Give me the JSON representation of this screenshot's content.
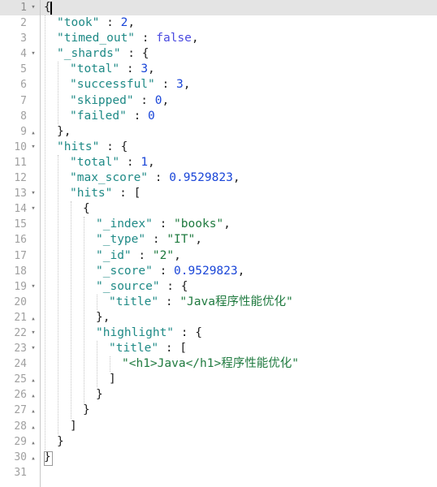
{
  "editor": {
    "title": "JSON response viewer",
    "language": "json",
    "total_lines": 31,
    "active_line": 1,
    "cursor": {
      "line": 1,
      "column": 2
    },
    "colors": {
      "background": "#ffffff",
      "active_line": "#e4e4e4",
      "gutter_border": "#c8c8c8",
      "line_number": "#a0a0a0",
      "key": "#1f8a86",
      "string": "#1f7a3f",
      "number": "#1a46d8",
      "boolean": "#4a4ae0",
      "punctuation": "#222222",
      "indent_guide": "#c4c4c4"
    },
    "fold_markers": {
      "open": "▾",
      "close": "▴"
    }
  },
  "lines": [
    {
      "num": "1",
      "fold": "open",
      "indent": 0,
      "tokens": [
        {
          "t": "p",
          "v": "{"
        }
      ]
    },
    {
      "num": "2",
      "fold": "",
      "indent": 1,
      "tokens": [
        {
          "t": "k",
          "v": "\"took\""
        },
        {
          "t": "p",
          "v": " : "
        },
        {
          "t": "n",
          "v": "2"
        },
        {
          "t": "p",
          "v": ","
        }
      ]
    },
    {
      "num": "3",
      "fold": "",
      "indent": 1,
      "tokens": [
        {
          "t": "k",
          "v": "\"timed_out\""
        },
        {
          "t": "p",
          "v": " : "
        },
        {
          "t": "b",
          "v": "false"
        },
        {
          "t": "p",
          "v": ","
        }
      ]
    },
    {
      "num": "4",
      "fold": "open",
      "indent": 1,
      "tokens": [
        {
          "t": "k",
          "v": "\"_shards\""
        },
        {
          "t": "p",
          "v": " : {"
        }
      ]
    },
    {
      "num": "5",
      "fold": "",
      "indent": 2,
      "tokens": [
        {
          "t": "k",
          "v": "\"total\""
        },
        {
          "t": "p",
          "v": " : "
        },
        {
          "t": "n",
          "v": "3"
        },
        {
          "t": "p",
          "v": ","
        }
      ]
    },
    {
      "num": "6",
      "fold": "",
      "indent": 2,
      "tokens": [
        {
          "t": "k",
          "v": "\"successful\""
        },
        {
          "t": "p",
          "v": " : "
        },
        {
          "t": "n",
          "v": "3"
        },
        {
          "t": "p",
          "v": ","
        }
      ]
    },
    {
      "num": "7",
      "fold": "",
      "indent": 2,
      "tokens": [
        {
          "t": "k",
          "v": "\"skipped\""
        },
        {
          "t": "p",
          "v": " : "
        },
        {
          "t": "n",
          "v": "0"
        },
        {
          "t": "p",
          "v": ","
        }
      ]
    },
    {
      "num": "8",
      "fold": "",
      "indent": 2,
      "tokens": [
        {
          "t": "k",
          "v": "\"failed\""
        },
        {
          "t": "p",
          "v": " : "
        },
        {
          "t": "n",
          "v": "0"
        }
      ]
    },
    {
      "num": "9",
      "fold": "close",
      "indent": 1,
      "tokens": [
        {
          "t": "p",
          "v": "},"
        }
      ]
    },
    {
      "num": "10",
      "fold": "open",
      "indent": 1,
      "tokens": [
        {
          "t": "k",
          "v": "\"hits\""
        },
        {
          "t": "p",
          "v": " : {"
        }
      ]
    },
    {
      "num": "11",
      "fold": "",
      "indent": 2,
      "tokens": [
        {
          "t": "k",
          "v": "\"total\""
        },
        {
          "t": "p",
          "v": " : "
        },
        {
          "t": "n",
          "v": "1"
        },
        {
          "t": "p",
          "v": ","
        }
      ]
    },
    {
      "num": "12",
      "fold": "",
      "indent": 2,
      "tokens": [
        {
          "t": "k",
          "v": "\"max_score\""
        },
        {
          "t": "p",
          "v": " : "
        },
        {
          "t": "n",
          "v": "0.9529823"
        },
        {
          "t": "p",
          "v": ","
        }
      ]
    },
    {
      "num": "13",
      "fold": "open",
      "indent": 2,
      "tokens": [
        {
          "t": "k",
          "v": "\"hits\""
        },
        {
          "t": "p",
          "v": " : ["
        }
      ]
    },
    {
      "num": "14",
      "fold": "open",
      "indent": 3,
      "tokens": [
        {
          "t": "p",
          "v": "{"
        }
      ]
    },
    {
      "num": "15",
      "fold": "",
      "indent": 4,
      "tokens": [
        {
          "t": "k",
          "v": "\"_index\""
        },
        {
          "t": "p",
          "v": " : "
        },
        {
          "t": "s",
          "v": "\"books\""
        },
        {
          "t": "p",
          "v": ","
        }
      ]
    },
    {
      "num": "16",
      "fold": "",
      "indent": 4,
      "tokens": [
        {
          "t": "k",
          "v": "\"_type\""
        },
        {
          "t": "p",
          "v": " : "
        },
        {
          "t": "s",
          "v": "\"IT\""
        },
        {
          "t": "p",
          "v": ","
        }
      ]
    },
    {
      "num": "17",
      "fold": "",
      "indent": 4,
      "tokens": [
        {
          "t": "k",
          "v": "\"_id\""
        },
        {
          "t": "p",
          "v": " : "
        },
        {
          "t": "s",
          "v": "\"2\""
        },
        {
          "t": "p",
          "v": ","
        }
      ]
    },
    {
      "num": "18",
      "fold": "",
      "indent": 4,
      "tokens": [
        {
          "t": "k",
          "v": "\"_score\""
        },
        {
          "t": "p",
          "v": " : "
        },
        {
          "t": "n",
          "v": "0.9529823"
        },
        {
          "t": "p",
          "v": ","
        }
      ]
    },
    {
      "num": "19",
      "fold": "open",
      "indent": 4,
      "tokens": [
        {
          "t": "k",
          "v": "\"_source\""
        },
        {
          "t": "p",
          "v": " : {"
        }
      ]
    },
    {
      "num": "20",
      "fold": "",
      "indent": 5,
      "tokens": [
        {
          "t": "k",
          "v": "\"title\""
        },
        {
          "t": "p",
          "v": " : "
        },
        {
          "t": "s",
          "v": "\"Java程序性能优化\""
        }
      ]
    },
    {
      "num": "21",
      "fold": "close",
      "indent": 4,
      "tokens": [
        {
          "t": "p",
          "v": "},"
        }
      ]
    },
    {
      "num": "22",
      "fold": "open",
      "indent": 4,
      "tokens": [
        {
          "t": "k",
          "v": "\"highlight\""
        },
        {
          "t": "p",
          "v": " : {"
        }
      ]
    },
    {
      "num": "23",
      "fold": "open",
      "indent": 5,
      "tokens": [
        {
          "t": "k",
          "v": "\"title\""
        },
        {
          "t": "p",
          "v": " : ["
        }
      ]
    },
    {
      "num": "24",
      "fold": "",
      "indent": 6,
      "tokens": [
        {
          "t": "s",
          "v": "\"<h1>Java</h1>程序性能优化\""
        }
      ]
    },
    {
      "num": "25",
      "fold": "close",
      "indent": 5,
      "tokens": [
        {
          "t": "p",
          "v": "]"
        }
      ]
    },
    {
      "num": "26",
      "fold": "close",
      "indent": 4,
      "tokens": [
        {
          "t": "p",
          "v": "}"
        }
      ]
    },
    {
      "num": "27",
      "fold": "close",
      "indent": 3,
      "tokens": [
        {
          "t": "p",
          "v": "}"
        }
      ]
    },
    {
      "num": "28",
      "fold": "close",
      "indent": 2,
      "tokens": [
        {
          "t": "p",
          "v": "]"
        }
      ]
    },
    {
      "num": "29",
      "fold": "close",
      "indent": 1,
      "tokens": [
        {
          "t": "p",
          "v": "}"
        }
      ]
    },
    {
      "num": "30",
      "fold": "close",
      "indent": 0,
      "tokens": [
        {
          "t": "p",
          "v": "}"
        }
      ]
    },
    {
      "num": "31",
      "fold": "",
      "indent": 0,
      "tokens": []
    }
  ],
  "indent_guides": [
    {
      "indent": 1,
      "from_line": 2,
      "to_line": 29
    },
    {
      "indent": 2,
      "from_line": 5,
      "to_line": 8
    },
    {
      "indent": 2,
      "from_line": 11,
      "to_line": 28
    },
    {
      "indent": 3,
      "from_line": 14,
      "to_line": 27
    },
    {
      "indent": 4,
      "from_line": 15,
      "to_line": 26
    },
    {
      "indent": 5,
      "from_line": 20,
      "to_line": 20
    },
    {
      "indent": 5,
      "from_line": 23,
      "to_line": 25
    },
    {
      "indent": 6,
      "from_line": 24,
      "to_line": 24
    }
  ],
  "document_content": {
    "took": 2,
    "timed_out": false,
    "_shards": {
      "total": 3,
      "successful": 3,
      "skipped": 0,
      "failed": 0
    },
    "hits": {
      "total": 1,
      "max_score": 0.9529823,
      "hits": [
        {
          "_index": "books",
          "_type": "IT",
          "_id": "2",
          "_score": 0.9529823,
          "_source": {
            "title": "Java程序性能优化"
          },
          "highlight": {
            "title": [
              "<h1>Java</h1>程序性能优化"
            ]
          }
        }
      ]
    }
  }
}
